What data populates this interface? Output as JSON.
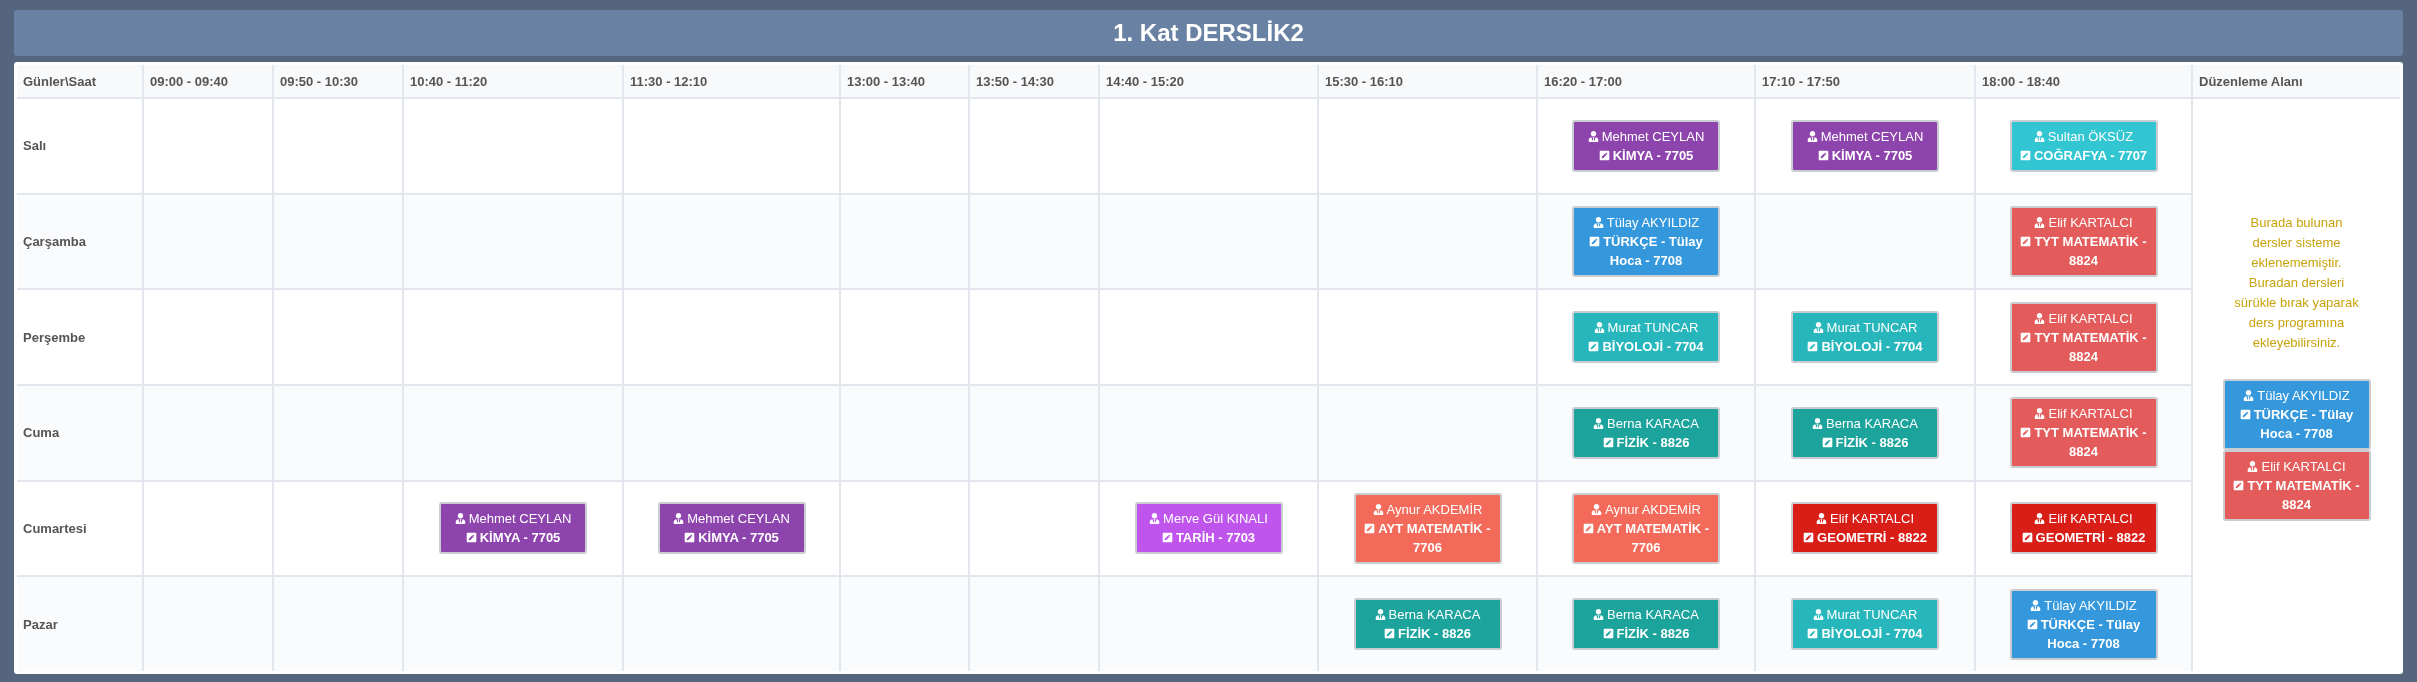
{
  "title": "1. Kat DERSLİK2",
  "columns": [
    "Günler\\Saat",
    "09:00 - 09:40",
    "09:50 - 10:30",
    "10:40 - 11:20",
    "11:30 - 12:10",
    "13:00 - 13:40",
    "13:50 - 14:30",
    "14:40 - 15:20",
    "15:30 - 16:10",
    "16:20 - 17:00",
    "17:10 - 17:50",
    "18:00 - 18:40",
    "Düzenleme Alanı"
  ],
  "rows": [
    {
      "day": "Salı",
      "cells": [
        {
          "kind": "empty"
        },
        {
          "kind": "empty"
        },
        {
          "kind": "empty"
        },
        {
          "kind": "empty"
        },
        {
          "kind": "empty"
        },
        {
          "kind": "empty"
        },
        {
          "kind": "empty"
        },
        {
          "kind": "empty"
        },
        {
          "kind": "lesson",
          "teacher": "Mehmet CEYLAN",
          "course": "KİMYA - 7705",
          "color": "#8e44ad"
        },
        {
          "kind": "lesson",
          "teacher": "Mehmet CEYLAN",
          "course": "KİMYA - 7705",
          "color": "#8e44ad"
        },
        {
          "kind": "lesson",
          "teacher": "Sultan ÖKSÜZ",
          "course": "COĞRAFYA - 7707",
          "color": "#32c5d2"
        }
      ]
    },
    {
      "day": "Çarşamba",
      "cells": [
        {
          "kind": "empty"
        },
        {
          "kind": "empty"
        },
        {
          "kind": "empty"
        },
        {
          "kind": "empty"
        },
        {
          "kind": "empty"
        },
        {
          "kind": "empty"
        },
        {
          "kind": "empty"
        },
        {
          "kind": "empty"
        },
        {
          "kind": "lesson",
          "teacher": "Tülay AKYILDIZ",
          "course": "TÜRKÇE - Tülay Hoca - 7708",
          "color": "#3598dc"
        },
        {
          "kind": "empty"
        },
        {
          "kind": "lesson",
          "teacher": "Elif KARTALCI",
          "course": "TYT MATEMATİK - 8824",
          "color": "#e35b5a"
        }
      ]
    },
    {
      "day": "Perşembe",
      "cells": [
        {
          "kind": "empty"
        },
        {
          "kind": "empty"
        },
        {
          "kind": "empty"
        },
        {
          "kind": "empty"
        },
        {
          "kind": "empty"
        },
        {
          "kind": "empty"
        },
        {
          "kind": "empty"
        },
        {
          "kind": "empty"
        },
        {
          "kind": "lesson",
          "teacher": "Murat TUNCAR",
          "course": "BİYOLOJİ - 7704",
          "color": "#26b6bc"
        },
        {
          "kind": "lesson",
          "teacher": "Murat TUNCAR",
          "course": "BİYOLOJİ - 7704",
          "color": "#26b6bc"
        },
        {
          "kind": "lesson",
          "teacher": "Elif KARTALCI",
          "course": "TYT MATEMATİK - 8824",
          "color": "#e35b5a"
        }
      ]
    },
    {
      "day": "Cuma",
      "cells": [
        {
          "kind": "empty"
        },
        {
          "kind": "empty"
        },
        {
          "kind": "empty"
        },
        {
          "kind": "empty"
        },
        {
          "kind": "empty"
        },
        {
          "kind": "empty"
        },
        {
          "kind": "empty"
        },
        {
          "kind": "empty"
        },
        {
          "kind": "lesson",
          "teacher": "Berna KARACA",
          "course": "FİZİK - 8826",
          "color": "#1ba39c"
        },
        {
          "kind": "lesson",
          "teacher": "Berna KARACA",
          "course": "FİZİK - 8826",
          "color": "#1ba39c"
        },
        {
          "kind": "lesson",
          "teacher": "Elif KARTALCI",
          "course": "TYT MATEMATİK - 8824",
          "color": "#e35b5a"
        }
      ]
    },
    {
      "day": "Cumartesi",
      "cells": [
        {
          "kind": "empty"
        },
        {
          "kind": "empty"
        },
        {
          "kind": "lesson",
          "teacher": "Mehmet CEYLAN",
          "course": "KİMYA - 7705",
          "color": "#8e44ad"
        },
        {
          "kind": "lesson",
          "teacher": "Mehmet CEYLAN",
          "course": "KİMYA - 7705",
          "color": "#8e44ad"
        },
        {
          "kind": "empty"
        },
        {
          "kind": "empty"
        },
        {
          "kind": "lesson",
          "teacher": "Merve Gül KINALI",
          "course": "TARİH - 7703",
          "color": "#bf55ec"
        },
        {
          "kind": "lesson",
          "teacher": "Aynur AKDEMİR",
          "course": "AYT MATEMATİK - 7706",
          "color": "#f36a5a"
        },
        {
          "kind": "lesson",
          "teacher": "Aynur AKDEMİR",
          "course": "AYT MATEMATİK - 7706",
          "color": "#f36a5a"
        },
        {
          "kind": "lesson",
          "teacher": "Elif KARTALCI",
          "course": "GEOMETRİ - 8822",
          "color": "#d91e18"
        },
        {
          "kind": "lesson",
          "teacher": "Elif KARTALCI",
          "course": "GEOMETRİ - 8822",
          "color": "#d91e18"
        }
      ]
    },
    {
      "day": "Pazar",
      "cells": [
        {
          "kind": "empty"
        },
        {
          "kind": "empty"
        },
        {
          "kind": "empty"
        },
        {
          "kind": "empty"
        },
        {
          "kind": "empty"
        },
        {
          "kind": "empty"
        },
        {
          "kind": "empty"
        },
        {
          "kind": "lesson",
          "teacher": "Berna KARACA",
          "course": "FİZİK - 8826",
          "color": "#1ba39c"
        },
        {
          "kind": "lesson",
          "teacher": "Berna KARACA",
          "course": "FİZİK - 8826",
          "color": "#1ba39c"
        },
        {
          "kind": "lesson",
          "teacher": "Murat TUNCAR",
          "course": "BİYOLOJİ - 7704",
          "color": "#26b6bc"
        },
        {
          "kind": "lesson",
          "teacher": "Tülay AKYILDIZ",
          "course": "TÜRKÇE - Tülay Hoca - 7708",
          "color": "#3598dc"
        }
      ]
    }
  ],
  "edit_area": {
    "note": "Burada bulunan dersler sisteme eklenememiştir. Buradan dersleri sürükle bırak yaparak ders programına ekleyebilirsiniz.",
    "lessons": [
      {
        "teacher": "Tülay AKYILDIZ",
        "course": "TÜRKÇE - Tülay Hoca - 7708",
        "color": "#3598dc"
      },
      {
        "teacher": "Elif KARTALCI",
        "course": "TYT MATEMATİK - 8824",
        "color": "#e35b5a"
      }
    ]
  }
}
